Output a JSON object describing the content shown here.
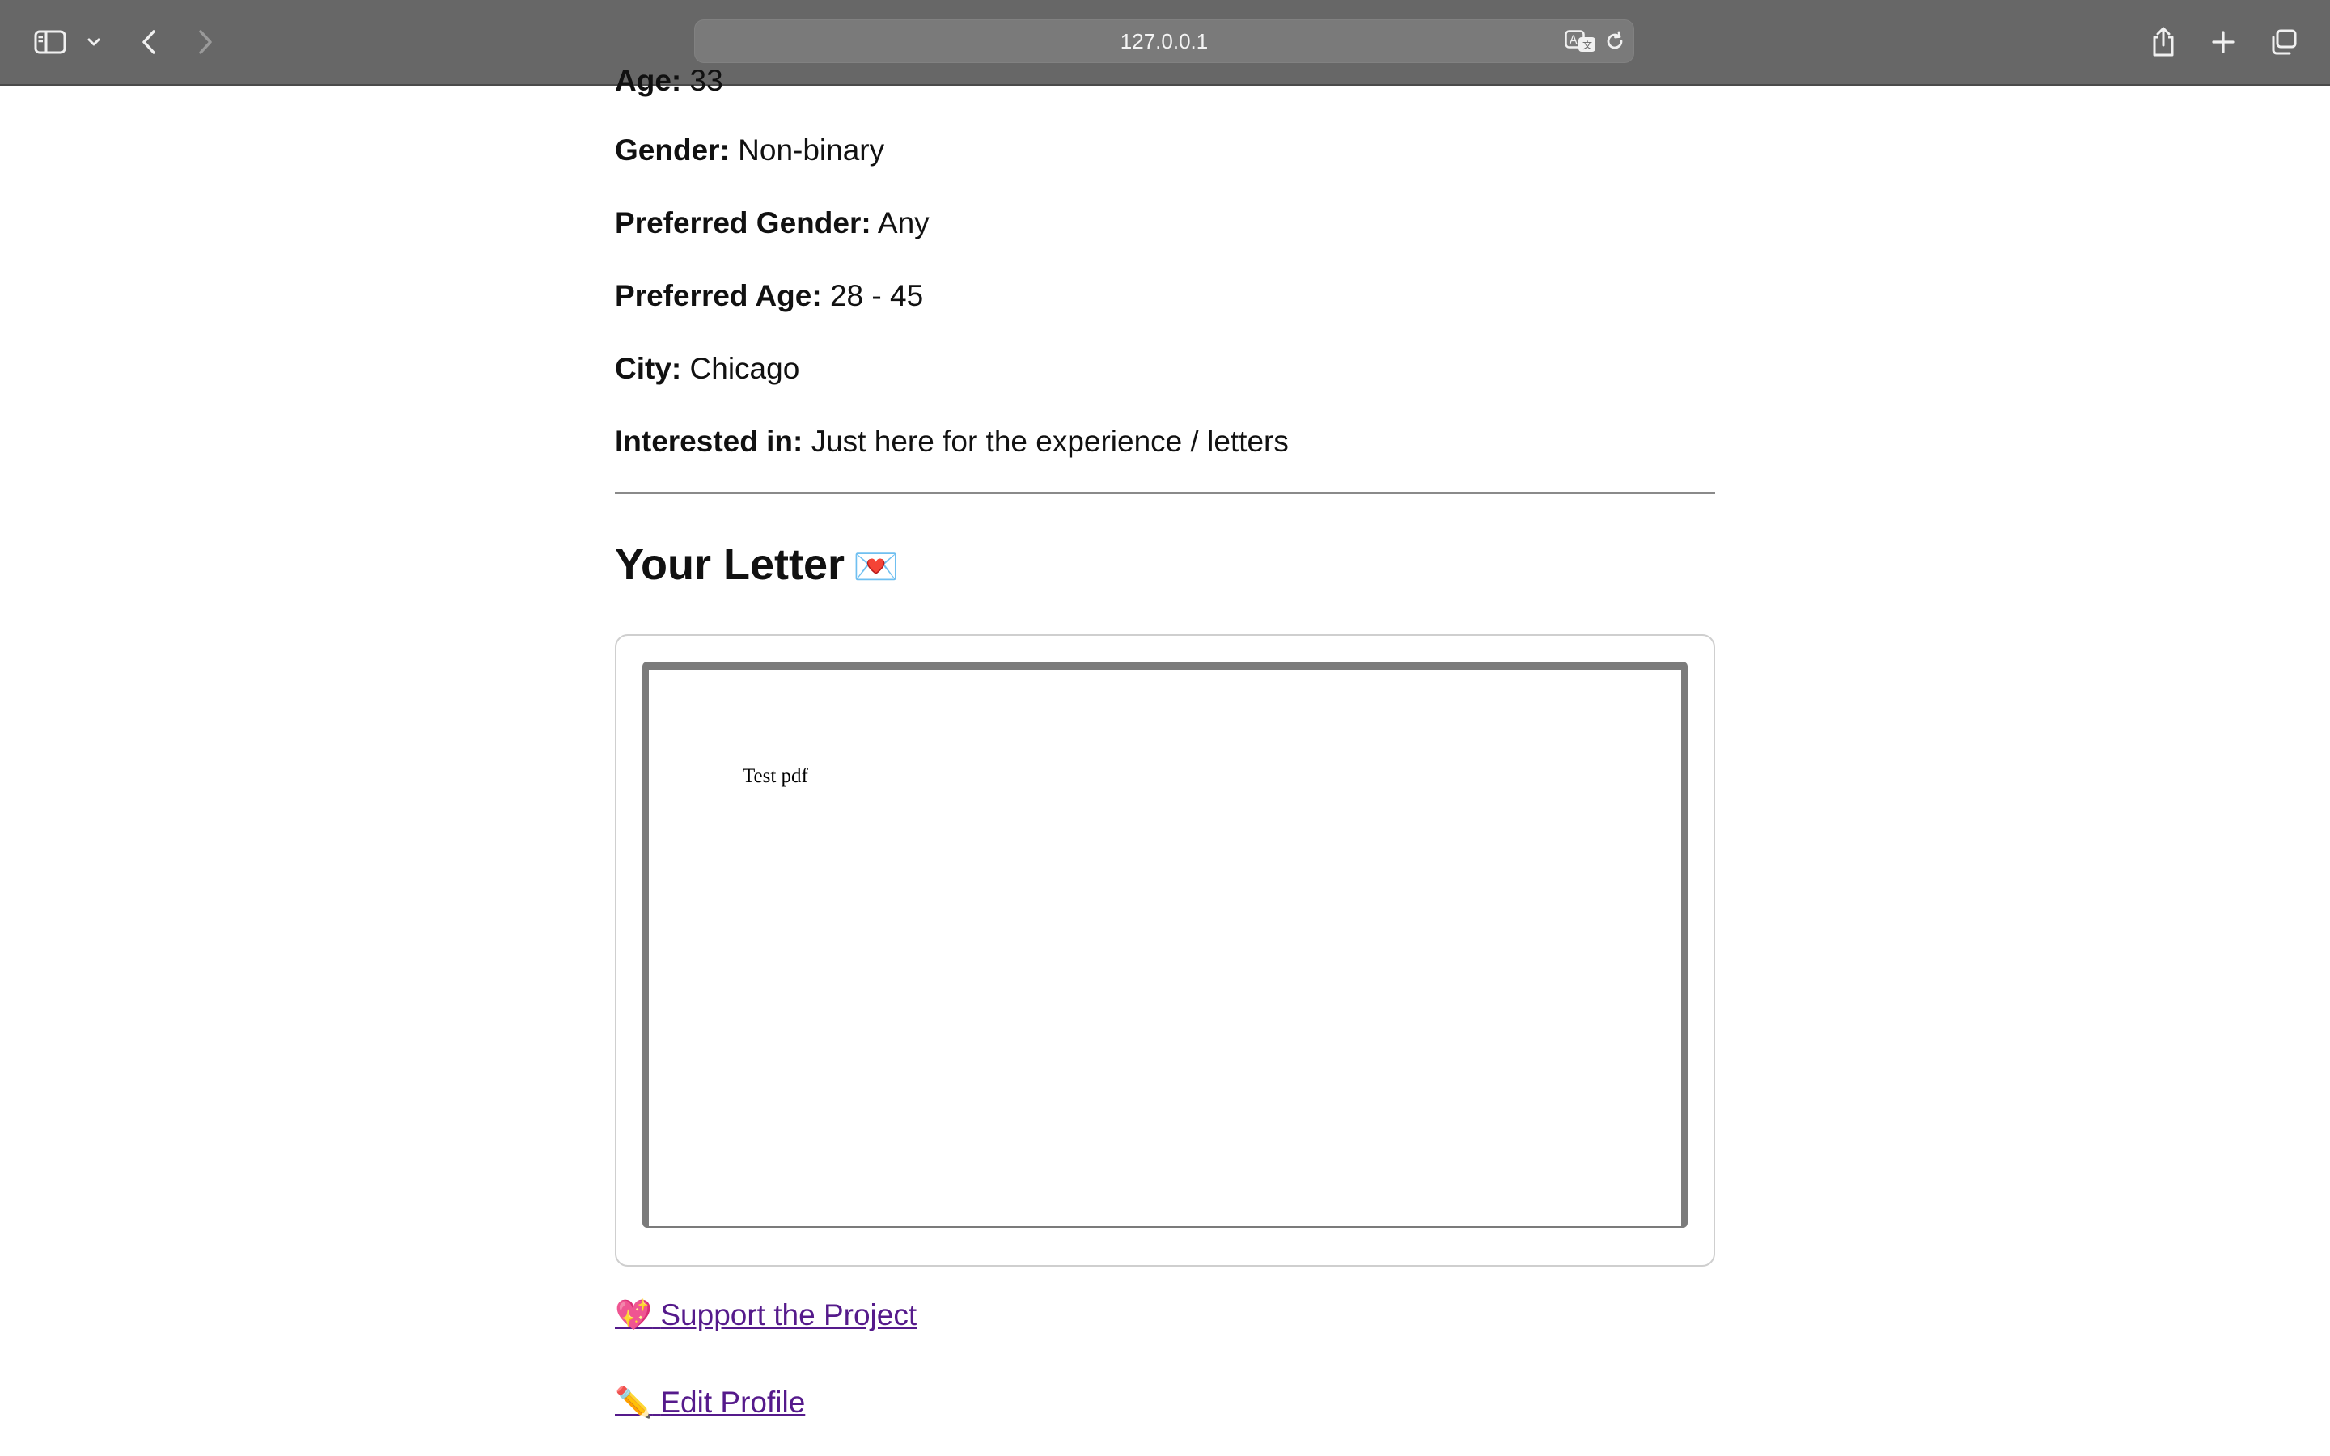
{
  "browser": {
    "url": "127.0.0.1",
    "icons": {
      "sidebar": "sidebar-icon",
      "dropdown": "chevron-down-icon",
      "back": "back-icon",
      "forward": "forward-icon",
      "translate": "translate-icon",
      "reload": "reload-icon",
      "share": "share-icon",
      "new_tab": "plus-icon",
      "tabs": "tabs-icon"
    }
  },
  "profile": {
    "age_label": "Age:",
    "age_value": "33",
    "gender_label": "Gender:",
    "gender_value": "Non-binary",
    "preferred_gender_label": "Preferred Gender:",
    "preferred_gender_value": "Any",
    "preferred_age_label": "Preferred Age:",
    "preferred_age_value": "28 - 45",
    "city_label": "City:",
    "city_value": "Chicago",
    "interested_label": "Interested in:",
    "interested_value": "Just here for the experience / letters"
  },
  "letter": {
    "heading": "Your Letter",
    "heading_emoji": "💌",
    "pdf_text": "Test pdf"
  },
  "links": {
    "support_emoji": "💖",
    "support_label": "Support the Project",
    "edit_emoji": "✏️",
    "edit_label": "Edit Profile"
  },
  "colors": {
    "toolbar": "#676767",
    "link": "#551a8b",
    "divider": "#8a8a8a"
  }
}
